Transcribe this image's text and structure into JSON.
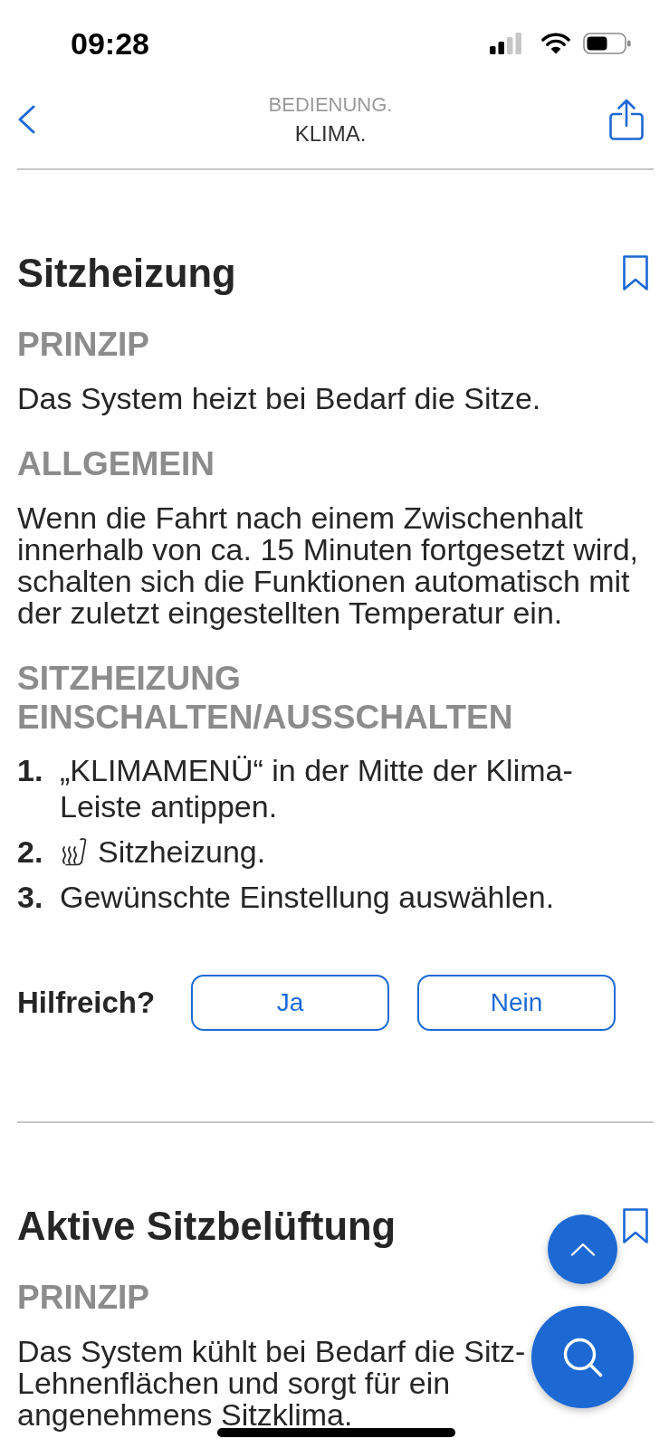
{
  "status_bar": {
    "time": "09:28"
  },
  "header": {
    "breadcrumb": "BEDIENUNG.",
    "title": "KLIMA."
  },
  "sections": [
    {
      "title": "Sitzheizung",
      "blocks": [
        {
          "kind": "heading",
          "text": "PRINZIP"
        },
        {
          "kind": "paragraph",
          "text": "Das System heizt bei Bedarf die Sitze."
        },
        {
          "kind": "heading",
          "text": "ALLGEMEIN"
        },
        {
          "kind": "paragraph",
          "text": "Wenn die Fahrt nach einem Zwischenhalt innerhalb von ca. 15 Minuten fortgesetzt wird, schalten sich die Funktionen automatisch mit der zuletzt eingestellten Temperatur ein."
        },
        {
          "kind": "heading",
          "text": "SITZHEIZUNG EINSCHALTEN/AUSSCHALTEN"
        },
        {
          "kind": "steps",
          "items": [
            {
              "kind": "plain",
              "number": "1.",
              "text": "„KLIMAMENÜ“ in der Mitte der Klima-Leiste antippen."
            },
            {
              "kind": "icon",
              "number": "2.",
              "text": "Sitzheizung."
            },
            {
              "kind": "plain",
              "number": "3.",
              "text": "Gewünschte Einstellung auswählen."
            }
          ]
        }
      ],
      "feedback": {
        "label": "Hilfreich?",
        "buttons": [
          "Ja",
          "Nein"
        ]
      }
    },
    {
      "title": "Aktive Sitzbelüftung",
      "blocks": [
        {
          "kind": "heading",
          "text": "PRINZIP"
        },
        {
          "kind": "paragraph",
          "text": "Das System kühlt bei Bedarf die Sitz- Lehnenflächen und sorgt für ein angenehmens Sitzklima."
        }
      ]
    }
  ]
}
